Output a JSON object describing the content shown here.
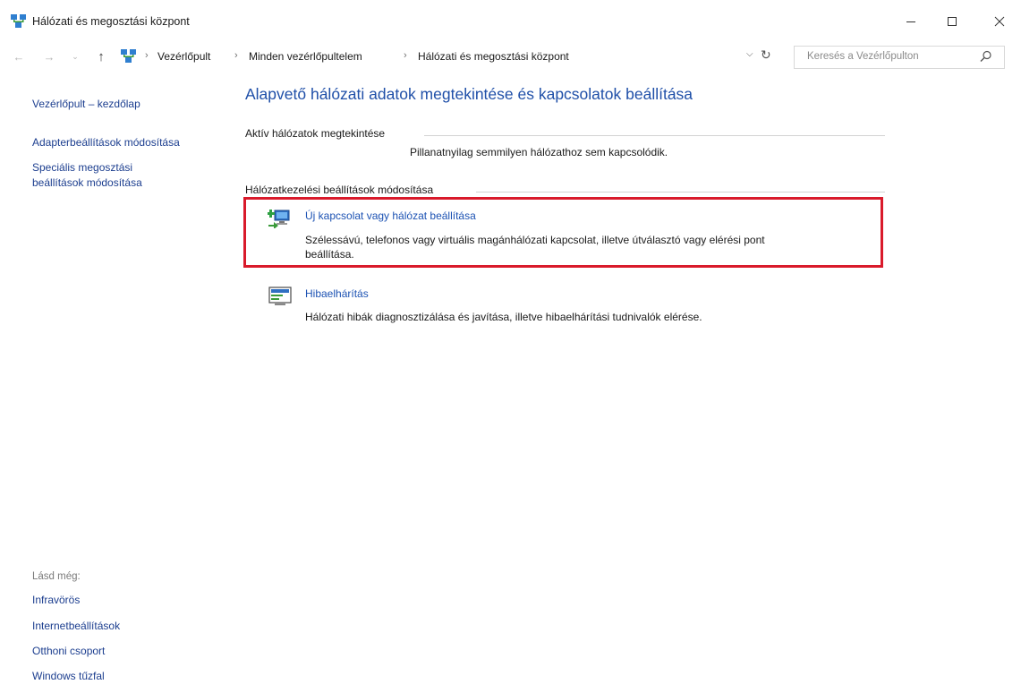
{
  "window": {
    "title": "Hálózati és megosztási központ",
    "controls": {
      "minimize": "minimize-icon",
      "maximize": "maximize-icon",
      "close": "close-icon"
    }
  },
  "address_bar": {
    "breadcrumbs": [
      "Vezérlőpult",
      "Minden vezérlőpultelem",
      "Hálózati és megosztási központ"
    ],
    "separator": "›",
    "search_placeholder": "Keresés a Vezérlőpulton"
  },
  "sidebar": {
    "home_link": "Vezérlőpult – kezdőlap",
    "links": [
      "Adapterbeállítások módosítása",
      "Speciális megosztási",
      "beállítások módosítása"
    ],
    "see_also_label": "Lásd még:",
    "see_also": [
      "Infravörös",
      "Internetbeállítások",
      "Otthoni csoport",
      "Windows tűzfal"
    ]
  },
  "main": {
    "title": "Alapvető hálózati adatok megtekintése és kapcsolatok beállítása",
    "active_networks_heading": "Aktív hálózatok megtekintése",
    "active_networks_status": "Pillanatnyilag semmilyen hálózathoz sem kapcsolódik.",
    "settings_heading": "Hálózatkezelési beállítások módosítása",
    "tasks": [
      {
        "title": "Új kapcsolat vagy hálózat beállítása",
        "desc_line1": "Szélessávú, telefonos vagy virtuális magánhálózati kapcsolat, illetve útválasztó vagy elérési pont",
        "desc_line2": "beállítása.",
        "icon": "new-connection-icon"
      },
      {
        "title": "Hibaelhárítás",
        "desc_line1": "Hálózati hibák diagnosztizálása és javítása, illetve hibaelhárítási tudnivalók elérése.",
        "icon": "troubleshoot-icon"
      }
    ]
  },
  "colors": {
    "link": "#1c3e8f",
    "title": "#1f4fa8",
    "highlight": "#d91a2b"
  }
}
